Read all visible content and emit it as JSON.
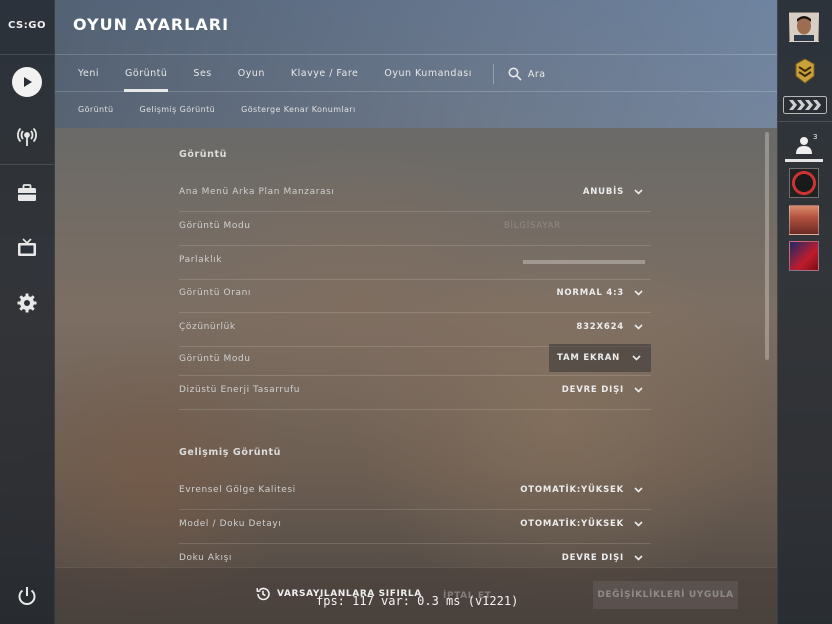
{
  "app": {
    "logo_text": "CS:GO"
  },
  "header": {
    "title": "OYUN AYARLARI",
    "tabs": [
      {
        "label": "Yeni",
        "active": false
      },
      {
        "label": "Görüntü",
        "active": true
      },
      {
        "label": "Ses",
        "active": false
      },
      {
        "label": "Oyun",
        "active": false
      },
      {
        "label": "Klavye / Fare",
        "active": false
      },
      {
        "label": "Oyun Kumandası",
        "active": false
      }
    ],
    "search_label": "Ara",
    "subtabs": [
      {
        "label": "Görüntü"
      },
      {
        "label": "Gelişmiş Görüntü"
      },
      {
        "label": "Gösterge Kenar Konumları"
      }
    ]
  },
  "sections": [
    {
      "title": "Görüntü",
      "rows": [
        {
          "label": "Ana Menü Arka Plan Manzarası",
          "value": "ANUBİS"
        },
        {
          "label": "Görüntü Modu",
          "value": "BİLGİSAYAR"
        },
        {
          "label": "Parlaklık",
          "slider": 0
        },
        {
          "label": "Görüntü Oranı",
          "value": "NORMAL 4:3"
        },
        {
          "label": "Çözünürlük",
          "value": "832X624"
        },
        {
          "label": "Görüntü Modu",
          "value": "TAM EKRAN"
        },
        {
          "label": "Dizüstü Enerji Tasarrufu",
          "value": "DEVRE DIŞI"
        }
      ]
    },
    {
      "title": "Gelişmiş Görüntü",
      "rows": [
        {
          "label": "Evrensel Gölge Kalitesi",
          "value": "OTOMATİK:YÜKSEK"
        },
        {
          "label": "Model / Doku Detayı",
          "value": "OTOMATİK:YÜKSEK"
        },
        {
          "label": "Doku Akışı",
          "value": "DEVRE DIŞI"
        }
      ]
    }
  ],
  "footer": {
    "reset_label": "VARSAYILANLARA SIFIRLA",
    "cancel_label": "İPTAL ET",
    "apply_label": "DEĞİŞİKLİKLERİ UYGULA"
  },
  "overlay": {
    "fps_text": "fps:   117 var:  0.3 ms (v1221)"
  },
  "friends": {
    "count": "3"
  },
  "colors": {
    "rail": "#1e242c",
    "accent": "#e6e6e6",
    "text": "#d6d6d6"
  }
}
